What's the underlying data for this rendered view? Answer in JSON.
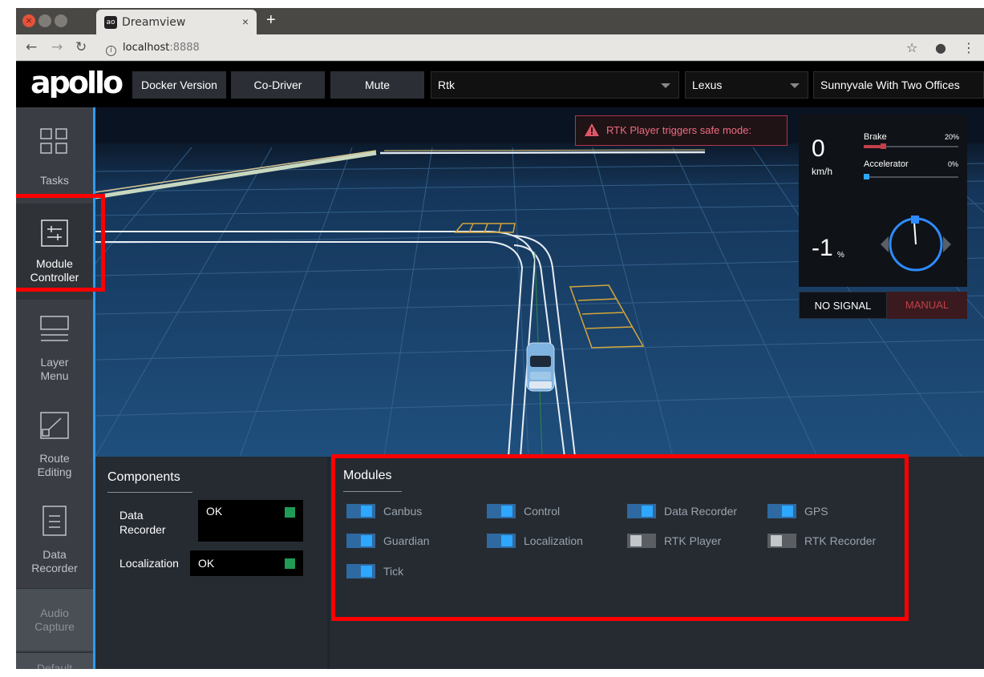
{
  "browser": {
    "tab_title": "Dreamview",
    "tab_close": "×",
    "new_tab": "+",
    "url_host": "localhost",
    "url_port": ":8888"
  },
  "header": {
    "logo_text": "apollo",
    "buttons": [
      "Docker Version",
      "Co-Driver",
      "Mute"
    ],
    "mode_select": "Rtk",
    "vehicle_select": "Lexus",
    "map_select": "Sunnyvale With Two Offices"
  },
  "sidebar": {
    "items": [
      {
        "label": "Tasks",
        "icon": "tasks-grid-icon"
      },
      {
        "label": "Module\nController",
        "icon": "module-controller-icon"
      },
      {
        "label": "Layer\nMenu",
        "icon": "layer-menu-icon"
      },
      {
        "label": "Route\nEditing",
        "icon": "route-editing-icon"
      },
      {
        "label": "Data\nRecorder",
        "icon": "data-recorder-icon"
      },
      {
        "label": "Audio\nCapture",
        "icon": ""
      },
      {
        "label": "Default",
        "icon": ""
      }
    ]
  },
  "alert": {
    "message": "RTK Player triggers safe mode:",
    "color": "#ef6b7f"
  },
  "dashboard": {
    "speed": "0",
    "speed_unit": "km/h",
    "brake_label": "Brake",
    "brake_value": "20%",
    "brake_fraction": 0.2,
    "accel_label": "Accelerator",
    "accel_value": "0%",
    "accel_fraction": 0.0,
    "steering": "-1",
    "steering_unit": "%",
    "signal": "NO SIGNAL",
    "drive_mode": "MANUAL"
  },
  "components": {
    "title": "Components",
    "items": [
      {
        "name": "Data\nRecorder",
        "status": "OK"
      },
      {
        "name": "Localization",
        "status": "OK"
      }
    ]
  },
  "modules": {
    "title": "Modules",
    "items": [
      {
        "label": "Canbus",
        "on": true
      },
      {
        "label": "Control",
        "on": true
      },
      {
        "label": "Data Recorder",
        "on": true
      },
      {
        "label": "GPS",
        "on": true
      },
      {
        "label": "Guardian",
        "on": true
      },
      {
        "label": "Localization",
        "on": true
      },
      {
        "label": "RTK Player",
        "on": false
      },
      {
        "label": "RTK Recorder",
        "on": false
      },
      {
        "label": "Tick",
        "on": true
      }
    ]
  },
  "colors": {
    "accent": "#2ea7ff",
    "highlight": "#ff0000",
    "ok": "#1f9b57",
    "manual": "#c0404a"
  }
}
